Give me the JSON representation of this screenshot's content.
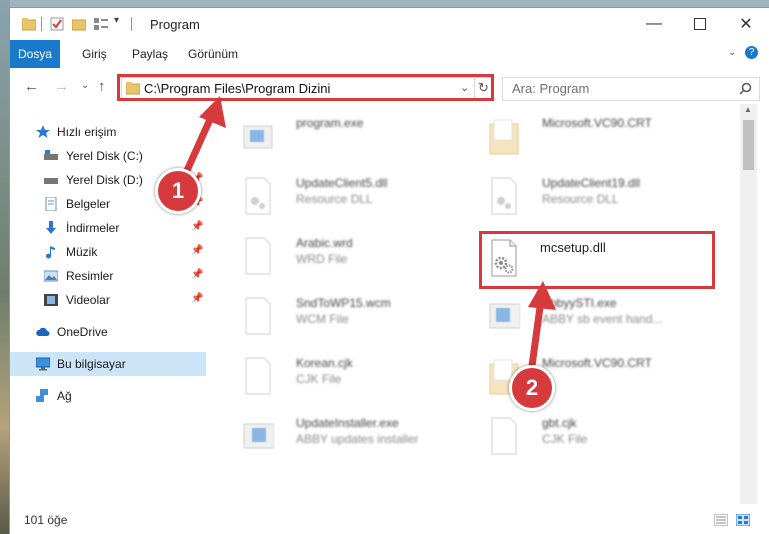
{
  "window": {
    "title": "Program"
  },
  "ribbon": {
    "tabs": [
      "Dosya",
      "Giriş",
      "Paylaş",
      "Görünüm"
    ]
  },
  "address": {
    "path": "C:\\Program Files\\Program Dizini"
  },
  "search": {
    "placeholder": "Ara: Program"
  },
  "nav": {
    "items": [
      {
        "label": "Hızlı erişim",
        "icon": "star-icon"
      },
      {
        "label": "Yerel Disk (C:)",
        "icon": "drive-icon",
        "pinned": true
      },
      {
        "label": "Yerel Disk (D:)",
        "icon": "drive-icon",
        "pinned": true
      },
      {
        "label": "Belgeler",
        "icon": "documents-icon",
        "pinned": true
      },
      {
        "label": "İndirmeler",
        "icon": "download-icon",
        "pinned": true
      },
      {
        "label": "Müzik",
        "icon": "music-icon",
        "pinned": true
      },
      {
        "label": "Resimler",
        "icon": "pictures-icon",
        "pinned": true
      },
      {
        "label": "Videolar",
        "icon": "videos-icon",
        "pinned": true
      },
      {
        "label": "OneDrive",
        "icon": "cloud-icon"
      },
      {
        "label": "Bu bilgisayar",
        "icon": "computer-icon"
      },
      {
        "label": "Ağ",
        "icon": "network-icon"
      }
    ]
  },
  "files": {
    "left": [
      {
        "name": "program.exe",
        "type": ""
      },
      {
        "name": "UpdateClient5.dll",
        "type": "Resource DLL"
      },
      {
        "name": "Arabic.wrd",
        "type": "WRD File"
      },
      {
        "name": "SndToWP15.wcm",
        "type": "WCM File"
      },
      {
        "name": "Korean.cjk",
        "type": "CJK File"
      },
      {
        "name": "UpdateInstaller.exe",
        "type": "ABBY updates installer"
      }
    ],
    "right": [
      {
        "name": "Microsoft.VC90.CRT",
        "type": ""
      },
      {
        "name": "UpdateClient19.dll",
        "type": "Resource DLL"
      },
      {
        "name": "mcsetup.dll",
        "type": ""
      },
      {
        "name": "AbbyySTI.exe",
        "type": "ABBY sb event hand..."
      },
      {
        "name": "Microsoft.VC90.CRT",
        "type": ""
      },
      {
        "name": "gbt.cjk",
        "type": "CJK File"
      }
    ]
  },
  "status": {
    "count": "101 öğe"
  },
  "annotations": {
    "step1": "1",
    "step2": "2"
  },
  "colors": {
    "accent": "#1979ca",
    "highlight": "#d9393c",
    "selection": "#cce4f7"
  }
}
